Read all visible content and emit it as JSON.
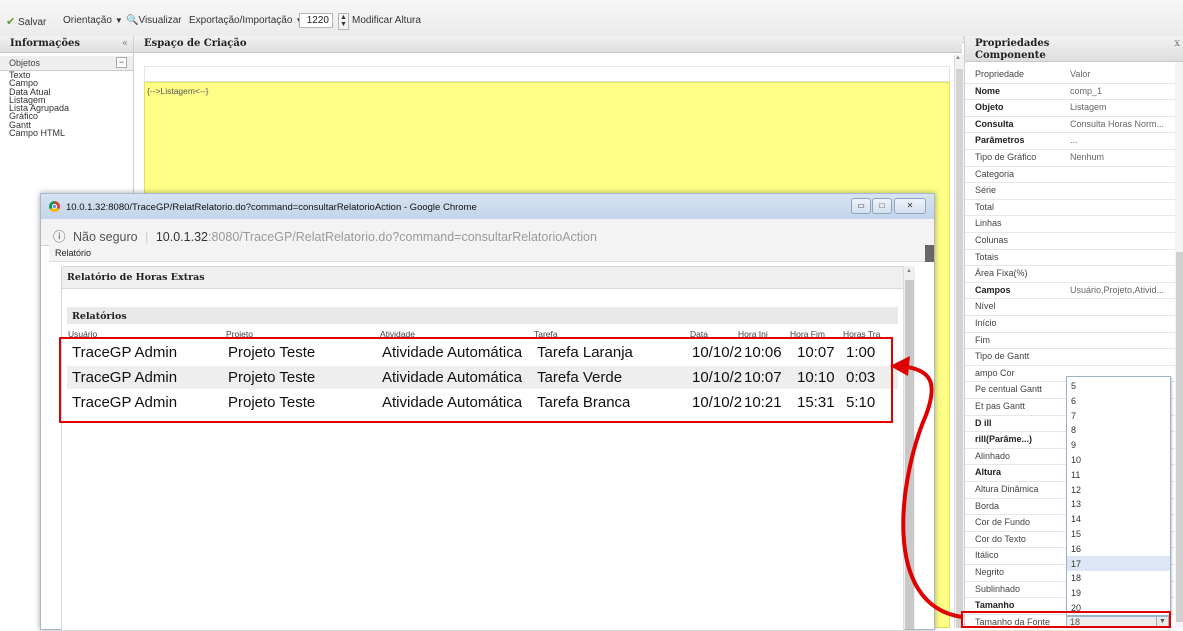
{
  "toolbar": {
    "save": "Salvar",
    "orientation": "Orientação",
    "preview": "Visualizar",
    "export_import": "Exportação/Importação",
    "zoom_value": "1220",
    "modify_height": "Modificar Altura"
  },
  "left_panel": {
    "title": "Informações",
    "objects_title": "Objetos",
    "objects": [
      "Texto",
      "Campo",
      "Data Atual",
      "Listagem",
      "Lista Agrupada",
      "Gráfico",
      "Gantt",
      "Campo HTML"
    ]
  },
  "center": {
    "title": "Espaço de Criação",
    "listing_tag": "{-->Listagem<--}"
  },
  "right_panel": {
    "title": "Propriedades",
    "subtitle": "Componente",
    "header_key": "Propriedade",
    "header_value": "Valor",
    "properties": [
      {
        "k": "Nome",
        "v": "comp_1",
        "bold": true
      },
      {
        "k": "Objeto",
        "v": "Listagem",
        "bold": true
      },
      {
        "k": "Consulta",
        "v": "Consulta Horas Norm...",
        "bold": true
      },
      {
        "k": "Parâmetros",
        "v": "...",
        "bold": true
      },
      {
        "k": "Tipo de Gráfico",
        "v": "Nenhum",
        "bold": false
      },
      {
        "k": "Categoria",
        "v": "",
        "bold": false
      },
      {
        "k": "Série",
        "v": "",
        "bold": false
      },
      {
        "k": "Total",
        "v": "",
        "bold": false
      },
      {
        "k": "Linhas",
        "v": "",
        "bold": false
      },
      {
        "k": "Colunas",
        "v": "",
        "bold": false
      },
      {
        "k": "Totais",
        "v": "",
        "bold": false
      },
      {
        "k": "Área Fixa(%)",
        "v": "",
        "bold": false
      },
      {
        "k": "Campos",
        "v": "Usuário,Projeto,Ativid...",
        "bold": true
      },
      {
        "k": "Nível",
        "v": "",
        "bold": false
      },
      {
        "k": "Início",
        "v": "",
        "bold": false
      },
      {
        "k": "Fim",
        "v": "",
        "bold": false
      },
      {
        "k": "Tipo de Gantt",
        "v": "",
        "bold": false
      },
      {
        "k": "ampo Cor",
        "v": "",
        "bold": false
      },
      {
        "k": "Pe centual Gantt",
        "v": "",
        "bold": false
      },
      {
        "k": "Et pas Gantt",
        "v": "",
        "bold": false
      },
      {
        "k": "D ill",
        "v": "",
        "bold": true
      },
      {
        "k": "rill(Parâme...)",
        "v": "",
        "bold": true
      },
      {
        "k": "Alinhado",
        "v": "",
        "bold": false
      },
      {
        "k": "Altura",
        "v": "",
        "bold": true
      },
      {
        "k": "Altura Dinâmica",
        "v": "",
        "bold": false
      },
      {
        "k": "Borda",
        "v": "",
        "bold": false
      },
      {
        "k": "Cor de Fundo",
        "v": "",
        "bold": false
      },
      {
        "k": "Cor do Texto",
        "v": "",
        "bold": false
      },
      {
        "k": "Itálico",
        "v": "",
        "bold": false
      },
      {
        "k": "Negrito",
        "v": "",
        "bold": false
      },
      {
        "k": "Sublinhado",
        "v": "",
        "bold": false
      },
      {
        "k": "Tamanho",
        "v": "",
        "bold": true
      },
      {
        "k": "Tamanho da Fonte",
        "v": "",
        "bold": false
      }
    ],
    "font_size_options": [
      "5",
      "6",
      "7",
      "8",
      "9",
      "10",
      "11",
      "12",
      "13",
      "14",
      "15",
      "16",
      "17",
      "18",
      "19",
      "20"
    ],
    "font_size_highlighted": "17",
    "font_size_selected": "18"
  },
  "popup": {
    "window_title": "10.0.1.32:8080/TraceGP/RelatRelatorio.do?command=consultarRelatorioAction - Google Chrome",
    "url_info": "ⓘ",
    "url_insecure": "Não seguro",
    "url_host": "10.0.1.32",
    "url_rest": ":8080/TraceGP/RelatRelatorio.do?command=consultarRelatorioAction",
    "breadcrumb": "Relatório",
    "report_title": "Relatório de Horas Extras",
    "section_title": "Relatórios",
    "columns": [
      "Usuário",
      "Projeto",
      "Atividade",
      "Tarefa",
      "Data",
      "Hora Ini",
      "Hora Fim",
      "Horas Tra"
    ],
    "rows": [
      [
        "TraceGP Admin",
        "Projeto Teste",
        "Atividade Automática",
        "Tarefa Laranja",
        "10/10/2",
        "10:06",
        "10:07",
        "1:00"
      ],
      [
        "TraceGP Admin",
        "Projeto Teste",
        "Atividade Automática",
        "Tarefa Verde",
        "10/10/2",
        "10:07",
        "10:10",
        "0:03"
      ],
      [
        "TraceGP Admin",
        "Projeto Teste",
        "Atividade Automática",
        "Tarefa Branca",
        "10/10/2",
        "10:21",
        "15:31",
        "5:10"
      ]
    ]
  },
  "colors": {
    "accent_red": "#e00000",
    "canvas_yellow": "#ffff88",
    "highlight_blue": "#dce6f5"
  }
}
